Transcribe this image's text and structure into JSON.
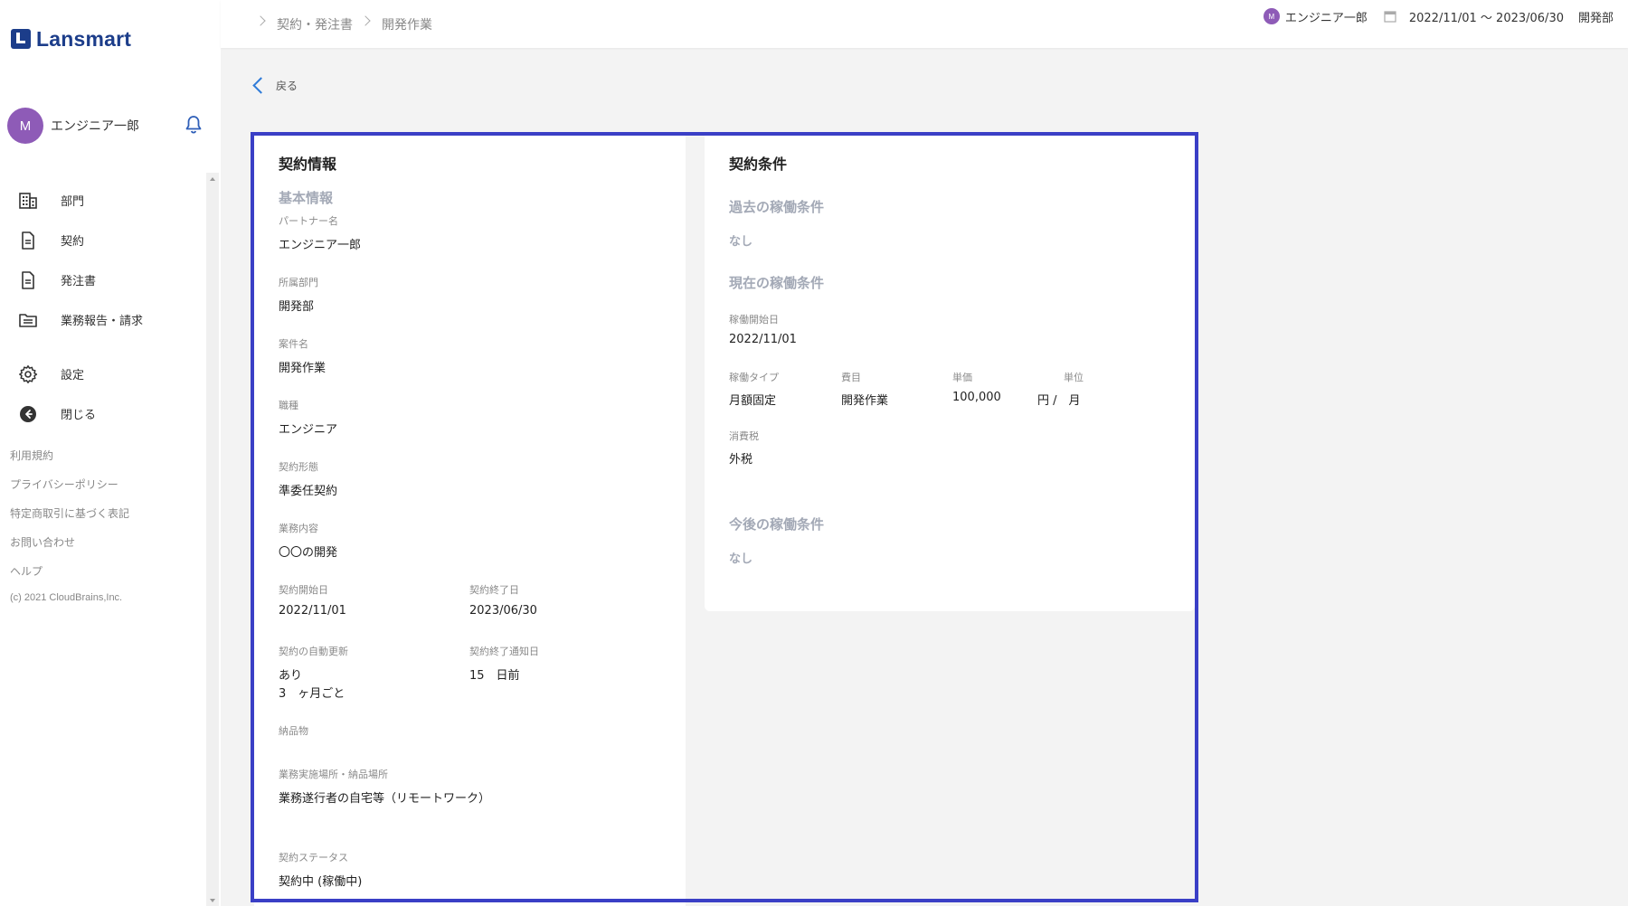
{
  "app": {
    "logo_text": "Lansmart"
  },
  "sidebar": {
    "user_initial": "M",
    "user_name": "エンジニア一郎",
    "nav": [
      {
        "label": "部門",
        "icon": "building-icon"
      },
      {
        "label": "契約",
        "icon": "document-icon"
      },
      {
        "label": "発注書",
        "icon": "document-icon"
      },
      {
        "label": "業務報告・請求",
        "icon": "folder-icon"
      },
      {
        "label": "設定",
        "icon": "gear-icon"
      },
      {
        "label": "閉じる",
        "icon": "arrow-left-circle-icon"
      }
    ],
    "footer_links": [
      "利用規約",
      "プライバシーポリシー",
      "特定商取引に基づく表記",
      "お問い合わせ",
      "ヘルプ"
    ],
    "copyright": "(c) 2021 CloudBrains,Inc."
  },
  "header": {
    "breadcrumb": [
      "契約・発注書",
      "開発作業"
    ],
    "user_initial": "M",
    "user_name": "エンジニア一郎",
    "period": "2022/11/01 〜 2023/06/30",
    "department": "開発部"
  },
  "back_label": "戻る",
  "contract_info": {
    "title": "契約情報",
    "section": "基本情報",
    "partner_label": "パートナー名",
    "partner_value": "エンジニア一郎",
    "dept_label": "所属部門",
    "dept_value": "開発部",
    "project_label": "案件名",
    "project_value": "開発作業",
    "job_label": "職種",
    "job_value": "エンジニア",
    "form_label": "契約形態",
    "form_value": "準委任契約",
    "work_label": "業務内容",
    "work_value": "〇〇の開発",
    "start_label": "契約開始日",
    "start_value": "2022/11/01",
    "end_label": "契約終了日",
    "end_value": "2023/06/30",
    "auto_label": "契約の自動更新",
    "auto_value": "あり",
    "auto_period": "3　ヶ月ごと",
    "notice_label": "契約終了通知日",
    "notice_value": "15　日前",
    "deliverable_label": "納品物",
    "place_label": "業務実施場所・納品場所",
    "place_value": "業務遂行者の自宅等（リモートワーク）",
    "status_label": "契約ステータス",
    "status_value": "契約中 (稼働中)"
  },
  "contract_terms": {
    "title": "契約条件",
    "past_title": "過去の稼働条件",
    "past_value": "なし",
    "current_title": "現在の稼働条件",
    "start_label": "稼働開始日",
    "start_value": "2022/11/01",
    "type_label": "稼働タイプ",
    "type_value": "月額固定",
    "item_label": "費目",
    "item_value": "開発作業",
    "price_label": "単価",
    "price_value": "100,000",
    "unit_label": "単位",
    "unit_value": "円 /　月",
    "tax_label": "消費税",
    "tax_value": "外税",
    "future_title": "今後の稼働条件",
    "future_value": "なし"
  },
  "colors": {
    "brand": "#1c3d8a",
    "avatar": "#8e5bb7",
    "frame": "#3a3fc6",
    "link": "#2f7bd8",
    "muted": "#a3a9b6"
  }
}
